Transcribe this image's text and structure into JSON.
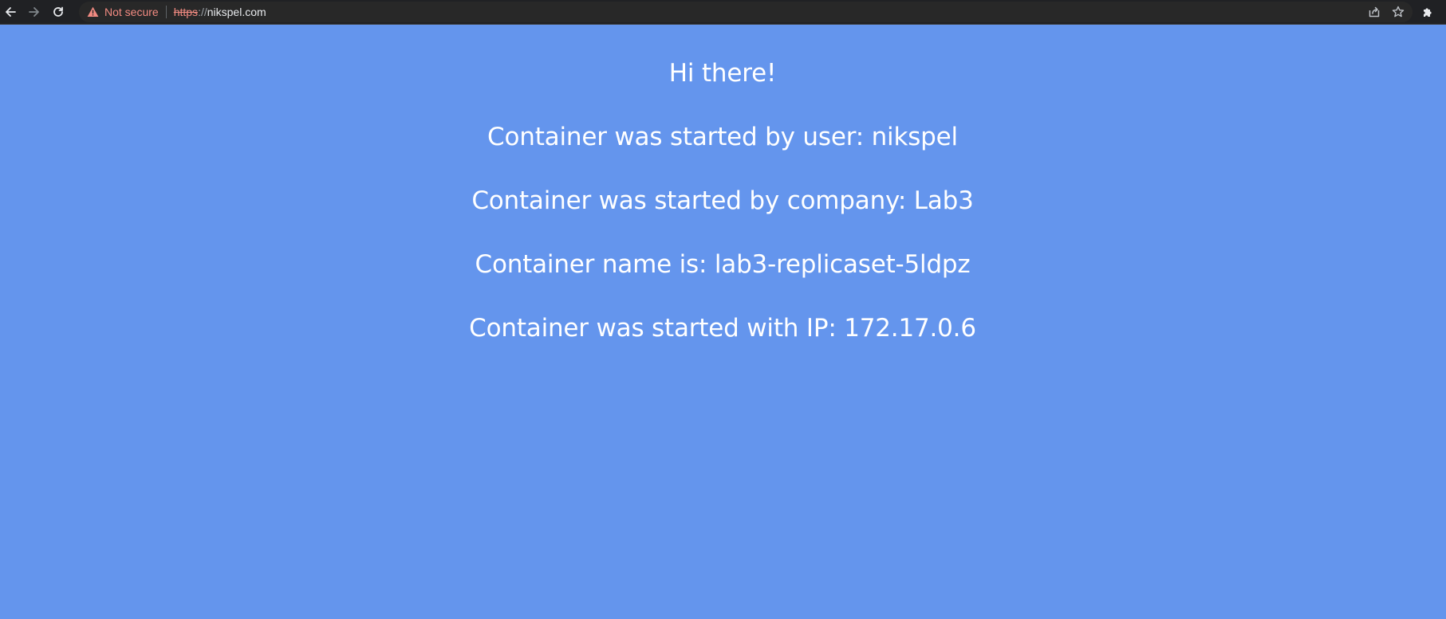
{
  "browser": {
    "security_label": "Not secure",
    "url_scheme": "https",
    "url_sep": "://",
    "url_host": "nikspel.com",
    "icons": {
      "back": "back-arrow-icon",
      "forward": "forward-arrow-icon",
      "reload": "reload-icon",
      "warning": "warning-triangle-icon",
      "share": "share-icon",
      "bookmark": "star-icon",
      "extensions": "puzzle-icon"
    }
  },
  "page": {
    "background_color": "#6495ed",
    "greeting": "Hi there!",
    "user_line": "Container was started by user: nikspel",
    "company_line": "Container was started by company: Lab3",
    "name_line": "Container name is: lab3-replicaset-5ldpz",
    "ip_line": "Container was started with IP: 172.17.0.6"
  }
}
